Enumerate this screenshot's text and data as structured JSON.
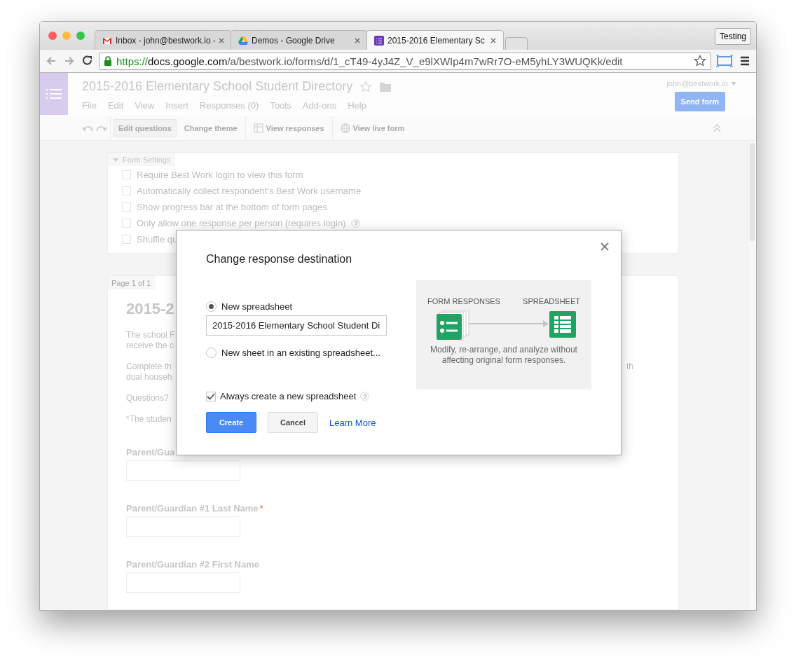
{
  "browser": {
    "tabs": [
      {
        "title": "Inbox - john@bestwork.io -",
        "selected": false
      },
      {
        "title": "Demos - Google Drive",
        "selected": false
      },
      {
        "title": "2015-2016 Elementary Sc",
        "selected": true
      }
    ],
    "profile_button": "Testing",
    "url": {
      "scheme": "https://",
      "host": "docs.google.com",
      "path": "/a/bestwork.io/forms/d/1_cT49-4yJ4Z_V_e9lXWIp4m7wRr7O-eM5yhLY3WUQKk/edit",
      "secure": true
    }
  },
  "doc": {
    "title": "2015-2016 Elementary School Student Directory",
    "starred": false,
    "menu": [
      "File",
      "Edit",
      "View",
      "Insert",
      "Responses (0)",
      "Tools",
      "Add-ons",
      "Help"
    ],
    "account": "john@bestwork.io",
    "send_button": "Send form"
  },
  "toolbar": {
    "items": [
      {
        "label": "Edit questions",
        "selected": true
      },
      {
        "label": "Change theme",
        "selected": false
      },
      {
        "label": "View responses",
        "selected": false
      },
      {
        "label": "View live form",
        "selected": false
      }
    ]
  },
  "form_settings": {
    "title": "Form Settings",
    "expanded": true,
    "options": [
      {
        "label": "Require Best Work login to view this form",
        "checked": false
      },
      {
        "label": "Automatically collect respondent's Best Work username",
        "checked": false
      },
      {
        "label": "Show progress bar at the bottom of form pages",
        "checked": false
      },
      {
        "label": "Only allow one response per person (requires login)",
        "checked": false,
        "help": "?"
      },
      {
        "label": "Shuffle qu",
        "checked": false
      }
    ]
  },
  "page": {
    "tab": "Page 1 of 1",
    "title": "2015-2",
    "paragraphs": [
      {
        "lines": [
          "The school F",
          "receive the c"
        ]
      },
      {
        "lines": [
          "Complete th",
          "dual househ"
        ],
        "tail": "th"
      },
      {
        "lines": [
          "Questions?"
        ]
      },
      {
        "lines": [
          "*The studen"
        ]
      }
    ],
    "questions": [
      {
        "label": "Parent/Gua"
      },
      {
        "label": "Parent/Guardian #1 Last Name",
        "required_mark": "*"
      },
      {
        "label": "Parent/Guardian #2 First Name"
      }
    ]
  },
  "dialog": {
    "title": "Change response destination",
    "options": [
      {
        "label": "New spreadsheet",
        "selected": true,
        "field_value": "2015-2016 Elementary School Student Di"
      },
      {
        "label": "New sheet in an existing spreadsheet...",
        "selected": false
      }
    ],
    "checkbox": {
      "label": "Always create a new spreadsheet",
      "checked": true,
      "help": "?"
    },
    "buttons": [
      {
        "label": "Create",
        "kind": "primary"
      },
      {
        "label": "Cancel",
        "kind": "secondary"
      },
      {
        "label": "Learn More",
        "kind": "link"
      }
    ],
    "illustration": {
      "source_label": "FORM RESPONSES",
      "target_label": "SPREADSHEET",
      "caption": "Modify, re-arrange, and analyze without affecting original form responses."
    }
  }
}
